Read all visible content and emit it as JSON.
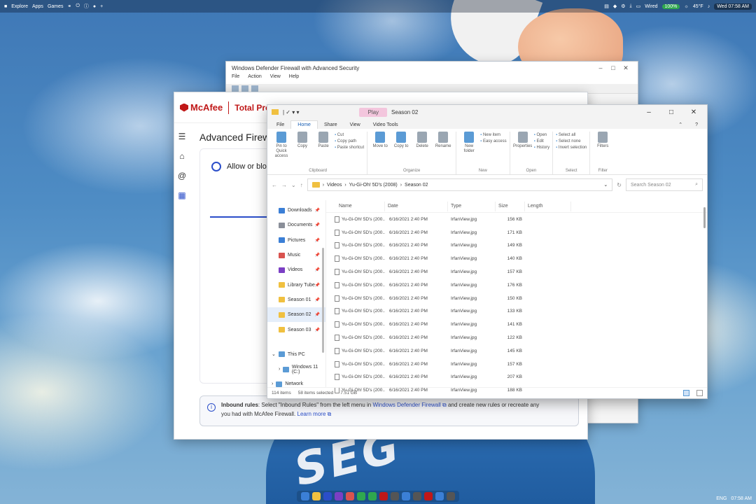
{
  "topbar": {
    "left_items": [
      "Explore",
      "Apps",
      "Games"
    ],
    "right_items": [
      "Wired",
      "100%",
      "45°F"
    ],
    "battery_badge": "100%",
    "clock": "Wed 07:58 AM"
  },
  "firewall_window": {
    "title": "Windows Defender Firewall with Advanced Security",
    "menu": [
      "File",
      "Action",
      "View",
      "Help"
    ]
  },
  "mcafee": {
    "logo": "McAfee",
    "product": "Total Protection",
    "page_title": "Advanced Firewall",
    "card_label": "Allow or block",
    "info": {
      "heading": "Inbound rules",
      "text_1": ": Select \"Inbound Rules\" from the left menu in ",
      "link_1": "Windows Defender Firewall",
      "text_2": " and create new rules or recreate any",
      "text_3": "you had with McAfee Firewall. ",
      "link_2": "Learn more"
    }
  },
  "explorer": {
    "context_tab": "Play",
    "title": "Season 02",
    "tabs": [
      "File",
      "Home",
      "Share",
      "View",
      "Video Tools"
    ],
    "active_tab": "Home",
    "ribbon": {
      "clipboard": {
        "label": "Clipboard",
        "buttons": [
          "Pin to Quick access",
          "Copy",
          "Paste"
        ],
        "small": [
          "Cut",
          "Copy path",
          "Paste shortcut"
        ]
      },
      "organize": {
        "label": "Organize",
        "buttons": [
          "Move to",
          "Copy to",
          "Delete",
          "Rename"
        ]
      },
      "new": {
        "label": "New",
        "buttons": [
          "New folder"
        ],
        "small": [
          "New item",
          "Easy access"
        ]
      },
      "open": {
        "label": "Open",
        "buttons": [
          "Properties"
        ],
        "small": [
          "Open",
          "Edit",
          "History"
        ]
      },
      "select": {
        "label": "Select",
        "small": [
          "Select all",
          "Select none",
          "Invert selection"
        ]
      },
      "filter": {
        "label": "Filter",
        "buttons": [
          "Filters"
        ]
      }
    },
    "breadcrumb": [
      "Videos",
      "Yu-Gi-Oh! 5D's (2008)",
      "Season 02"
    ],
    "search_placeholder": "Search Season 02",
    "nav": [
      {
        "label": "Downloads",
        "color": "#3b7fd6"
      },
      {
        "label": "Documents",
        "color": "#8a8f99"
      },
      {
        "label": "Pictures",
        "color": "#3b7fd6"
      },
      {
        "label": "Music",
        "color": "#d9534f"
      },
      {
        "label": "Videos",
        "color": "#7b3fc4"
      },
      {
        "label": "Library Tube",
        "color": "#f0c040"
      },
      {
        "label": "Season 01",
        "color": "#f0c040"
      },
      {
        "label": "Season 02",
        "color": "#f0c040"
      },
      {
        "label": "Season 03",
        "color": "#f0c040"
      }
    ],
    "nav_tree": [
      {
        "label": "This PC",
        "color": "#5b9bd5"
      },
      {
        "label": "Windows 11 (C:)",
        "color": "#5b9bd5"
      },
      {
        "label": "Network",
        "color": "#5b9bd5"
      }
    ],
    "columns": [
      "Name",
      "Date",
      "Type",
      "Size",
      "Length"
    ],
    "rows": [
      {
        "name": "Yu-Gi-Oh! 5D's (200...",
        "date": "6/16/2021 2:40 PM",
        "type": "IrfanView.jpg",
        "size": "156 KB"
      },
      {
        "name": "Yu-Gi-Oh! 5D's (200...",
        "date": "6/16/2021 2:40 PM",
        "type": "IrfanView.jpg",
        "size": "171 KB"
      },
      {
        "name": "Yu-Gi-Oh! 5D's (200...",
        "date": "6/16/2021 2:40 PM",
        "type": "IrfanView.jpg",
        "size": "149 KB"
      },
      {
        "name": "Yu-Gi-Oh! 5D's (200...",
        "date": "6/16/2021 2:40 PM",
        "type": "IrfanView.jpg",
        "size": "140 KB"
      },
      {
        "name": "Yu-Gi-Oh! 5D's (200...",
        "date": "6/16/2021 2:40 PM",
        "type": "IrfanView.jpg",
        "size": "157 KB"
      },
      {
        "name": "Yu-Gi-Oh! 5D's (200...",
        "date": "6/16/2021 2:40 PM",
        "type": "IrfanView.jpg",
        "size": "176 KB"
      },
      {
        "name": "Yu-Gi-Oh! 5D's (200...",
        "date": "6/16/2021 2:40 PM",
        "type": "IrfanView.jpg",
        "size": "150 KB"
      },
      {
        "name": "Yu-Gi-Oh! 5D's (200...",
        "date": "6/16/2021 2:40 PM",
        "type": "IrfanView.jpg",
        "size": "133 KB"
      },
      {
        "name": "Yu-Gi-Oh! 5D's (200...",
        "date": "6/16/2021 2:40 PM",
        "type": "IrfanView.jpg",
        "size": "141 KB"
      },
      {
        "name": "Yu-Gi-Oh! 5D's (200...",
        "date": "6/16/2021 2:40 PM",
        "type": "IrfanView.jpg",
        "size": "122 KB"
      },
      {
        "name": "Yu-Gi-Oh! 5D's (200...",
        "date": "6/16/2021 2:40 PM",
        "type": "IrfanView.jpg",
        "size": "145 KB"
      },
      {
        "name": "Yu-Gi-Oh! 5D's (200...",
        "date": "6/16/2021 2:40 PM",
        "type": "IrfanView.jpg",
        "size": "157 KB"
      },
      {
        "name": "Yu-Gi-Oh! 5D's (200...",
        "date": "6/16/2021 2:40 PM",
        "type": "IrfanView.jpg",
        "size": "207 KB"
      },
      {
        "name": "Yu-Gi-Oh! 5D's (200...",
        "date": "6/16/2021 2:40 PM",
        "type": "IrfanView.jpg",
        "size": "188 KB"
      }
    ],
    "status": {
      "items": "114 items",
      "selected": "58 items selected",
      "size": "7.51 GB"
    }
  },
  "taskbar": {
    "app_colors": [
      "#3b7fd6",
      "#f0c040",
      "#2b4ec9",
      "#7b3fc4",
      "#d9534f",
      "#2fa84f",
      "#2fa84f",
      "#c01818",
      "#555555",
      "#3b7fd6",
      "#555555",
      "#c01818",
      "#3b7fd6",
      "#555555"
    ],
    "tray": [
      "ENG",
      "07:58 AM"
    ]
  },
  "wallpaper": {
    "shirt_text": "SEG"
  }
}
